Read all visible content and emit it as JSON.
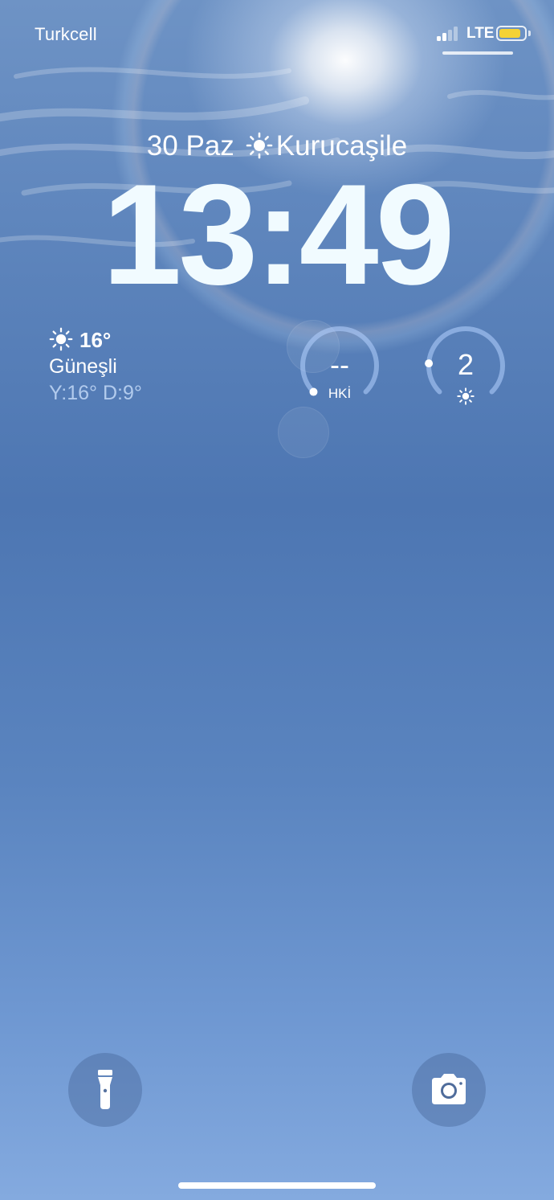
{
  "status_bar": {
    "carrier": "Turkcell",
    "network": "LTE",
    "signal_bars_active": 2,
    "signal_bars_total": 4,
    "battery_level": 0.85,
    "battery_color": "#f4d235"
  },
  "lock_screen": {
    "date": "30 Paz",
    "location": "Kurucaşile",
    "location_icon": "sun-icon",
    "time": "13:49"
  },
  "weather_widget": {
    "icon": "sun-icon",
    "temperature": "16°",
    "condition": "Güneşli",
    "high_low": "Y:16° D:9°"
  },
  "air_quality_gauge": {
    "value": "--",
    "label": "HKİ",
    "level": 0
  },
  "uv_gauge": {
    "value": "2",
    "icon": "sun-icon",
    "level": 0.18
  },
  "quick_actions": {
    "flashlight_icon": "flashlight-icon",
    "camera_icon": "camera-icon"
  },
  "colors": {
    "sky_top": "#6e93c5",
    "sky_mid": "#4d76b2",
    "sky_bottom": "#84aadf",
    "clock": "#f1fbff"
  }
}
